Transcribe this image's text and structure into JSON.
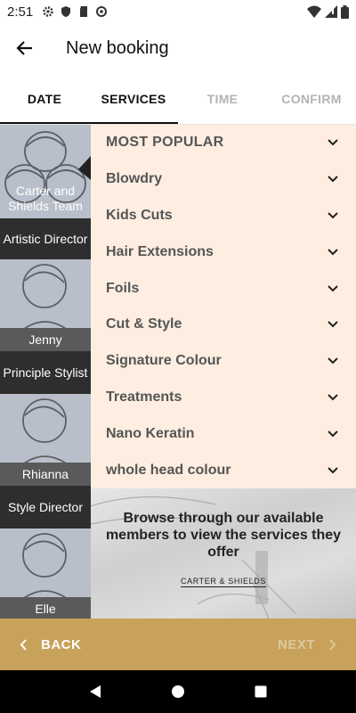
{
  "status_bar": {
    "time": "2:51",
    "icons": [
      "settings-icon",
      "shield-icon",
      "sd-card-icon",
      "sync-icon",
      "wifi-icon",
      "signal-icon",
      "battery-icon"
    ]
  },
  "app_bar": {
    "back_icon": "arrow-left-icon",
    "title": "New booking"
  },
  "tabs": [
    {
      "label": "DATE",
      "state": "active"
    },
    {
      "label": "SERVICES",
      "state": "active"
    },
    {
      "label": "TIME",
      "state": "disabled"
    },
    {
      "label": "CONFIRM",
      "state": "disabled"
    }
  ],
  "staff": [
    {
      "name": "Carter and\nShields Team",
      "role": "Artistic Director"
    },
    {
      "name": "Jenny",
      "role": "Principle Stylist"
    },
    {
      "name": "Rhianna",
      "role": "Style Director"
    },
    {
      "name": "Elle",
      "role": ""
    }
  ],
  "services": {
    "header": "MOST POPULAR",
    "items": [
      "Blowdry",
      "Kids Cuts",
      "Hair Extensions",
      "Foils",
      "Cut & Style",
      "Signature Colour",
      "Treatments",
      "Nano Keratin",
      "whole head colour"
    ]
  },
  "promo": {
    "message": "Browse through our available members to view the services they offer",
    "brand": "CARTER & SHIELDS"
  },
  "footer": {
    "back_label": "BACK",
    "next_label": "NEXT"
  },
  "colors": {
    "accent": "#c8a25a",
    "services_bg": "#fdeee1",
    "role_band": "#2e2e2e"
  }
}
